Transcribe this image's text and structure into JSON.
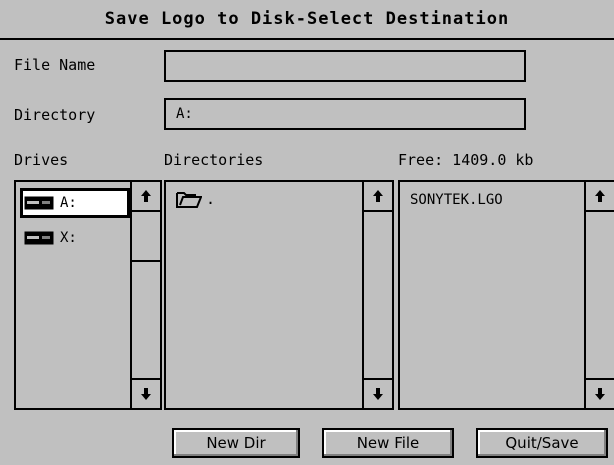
{
  "dialog": {
    "title": "Save Logo to Disk-Select Destination"
  },
  "labels": {
    "file_name": "File Name",
    "directory": "Directory",
    "drives": "Drives",
    "directories": "Directories",
    "free": "Free: 1409.0 kb"
  },
  "fields": {
    "file_name_value": "",
    "directory_value": "A:"
  },
  "drives": [
    {
      "label": "A:",
      "selected": true
    },
    {
      "label": "X:",
      "selected": false
    }
  ],
  "directories": [
    {
      "label": "."
    }
  ],
  "files": [
    {
      "label": "SONYTEK.LGO"
    }
  ],
  "buttons": {
    "new_dir": "New Dir",
    "new_file": "New File",
    "quit_save": "Quit/Save"
  },
  "icons": {
    "drive": "drive-icon",
    "folder": "folder-open-icon",
    "up": "arrow-up-icon",
    "down": "arrow-down-icon"
  }
}
